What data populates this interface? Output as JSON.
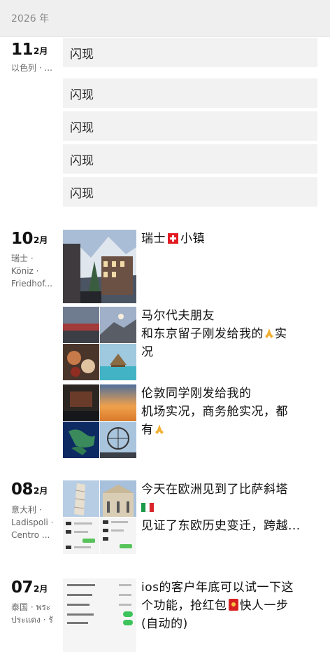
{
  "year_label": "2026 年",
  "sections": [
    {
      "day": "11",
      "month": "2月",
      "location_lines": [
        "以色列 · ..."
      ],
      "flash_label": "闪现",
      "flash_count": 5
    },
    {
      "day": "10",
      "month": "2月",
      "location_lines": [
        "瑞士 ·",
        "Köniz ·",
        "Friedhof..."
      ],
      "posts": [
        {
          "text_before": "瑞士",
          "text_after": "小镇",
          "icon": "swiss-flag-icon"
        },
        {
          "line1": "马尔代夫朋友",
          "line2_before": "和东京留子刚发给我的",
          "line2_after": "实",
          "line3": "况",
          "icon": "folded-hands-icon"
        },
        {
          "line1": "伦敦同学刚发给我的",
          "line2": "机场实况，商务舱实况，都",
          "line3_before": "有",
          "icon": "folded-hands-icon"
        }
      ]
    },
    {
      "day": "08",
      "month": "2月",
      "location_lines": [
        "意大利 ·",
        "Ladispoli ·",
        "Centro ..."
      ],
      "post": {
        "line1": "今天在欧洲见到了比萨斜塔",
        "line3": "见证了东欧历史变迁，跨越...",
        "icon": "italy-flag-icon"
      }
    },
    {
      "day": "07",
      "month": "2月",
      "location_lines": [
        "泰国 · พระ",
        "ประแดง · รั"
      ],
      "post": {
        "line1": "ios的客户年底可以试一下这",
        "line2_before": "个功能，抢红包",
        "line2_after": "快人一步",
        "line3": "(自动的)",
        "icon": "red-envelope-icon"
      }
    }
  ]
}
